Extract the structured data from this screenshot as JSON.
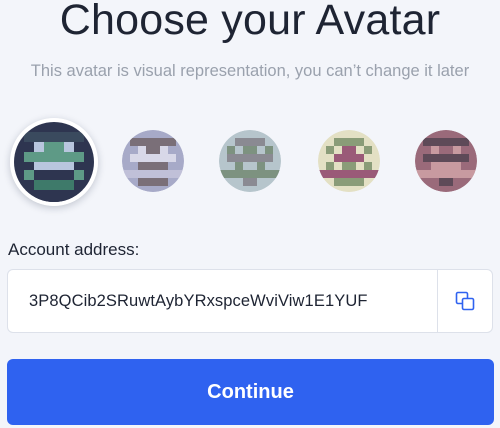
{
  "header": {
    "title": "Choose your Avatar",
    "subtitle": "This avatar is visual representation, you can’t change it later"
  },
  "avatars": {
    "selected_index": 0,
    "items": [
      {
        "name": "avatar-1",
        "colors": {
          "bg": "#2e3550",
          "fg": "#5e9a86",
          "accent": "#b8c6de"
        }
      },
      {
        "name": "avatar-2",
        "colors": {
          "bg": "#a7aac8",
          "fg": "#7a6f78",
          "accent": "#d8d8e8"
        }
      },
      {
        "name": "avatar-3",
        "colors": {
          "bg": "#b6c5cc",
          "fg": "#7d9280",
          "accent": "#8a8a92"
        }
      },
      {
        "name": "avatar-4",
        "colors": {
          "bg": "#e3e0c4",
          "fg": "#8a9c78",
          "accent": "#9a5a78"
        }
      },
      {
        "name": "avatar-5",
        "colors": {
          "bg": "#9a6a7a",
          "fg": "#c89aa0",
          "accent": "#5e4a58"
        }
      }
    ]
  },
  "account": {
    "label": "Account address:",
    "address": "3P8QCib2SRuwtAybYRxspceWviViw1E1YUF",
    "copy_icon": "copy-icon"
  },
  "actions": {
    "continue_label": "Continue"
  },
  "colors": {
    "primary": "#2f62f0",
    "text": "#1e2433",
    "muted": "#9aa1ad",
    "background": "#f3f5fa"
  }
}
